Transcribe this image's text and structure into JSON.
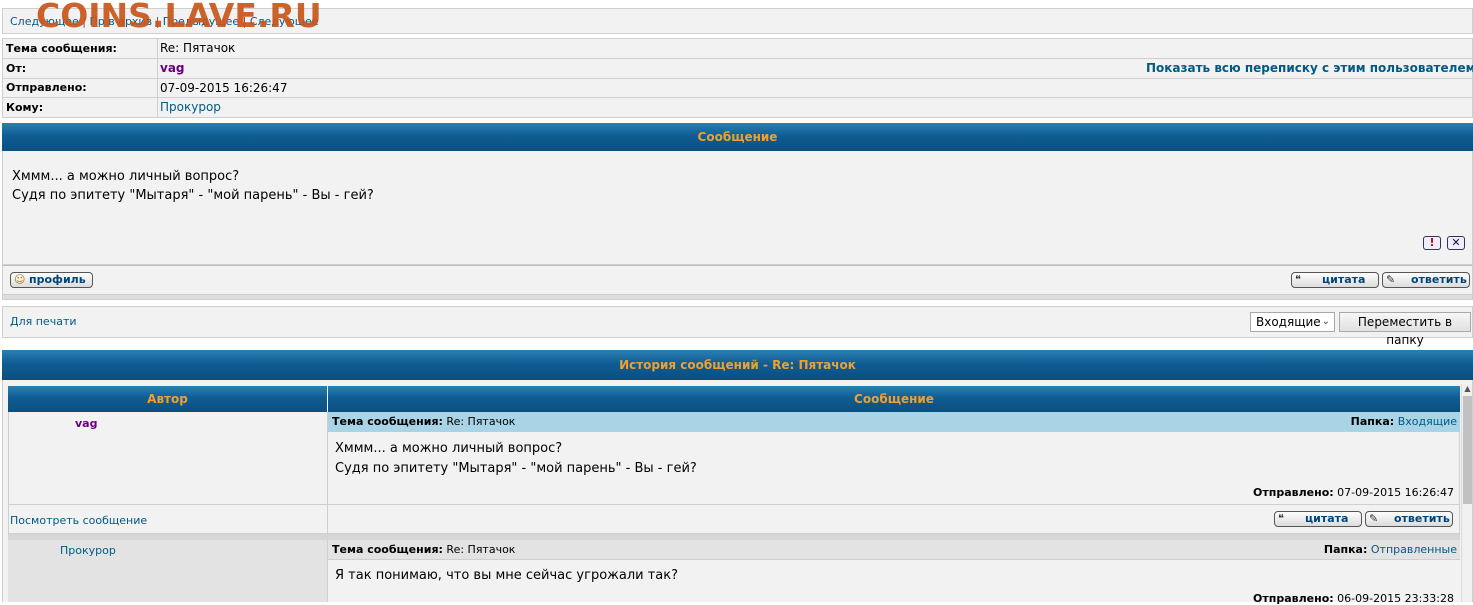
{
  "watermark": "COINS.LAVE.RU",
  "topnav": {
    "items": [
      "Следующее",
      "Пр в архив",
      "Предыдущее",
      "Следующее"
    ],
    "sep": "|"
  },
  "header": {
    "subject_label": "Тема сообщения:",
    "subject_value": "Re: Пятачок",
    "from_label": "От:",
    "from_value": "vag",
    "show_all_link": "Показать всю переписку с этим пользователем",
    "sent_label": "Отправлено:",
    "sent_value": "07-09-2015 16:26:47",
    "to_label": "Кому:",
    "to_value": "Прокурор"
  },
  "message": {
    "title": "Сообщение",
    "line1": "Хммм... а можно личный вопрос?",
    "line2": "Судя по эпитету \"Мытаря\" - \"мой парень\" - Вы - гей?",
    "profile_btn": "профиль",
    "quote_btn": "цитата",
    "reply_btn": "ответить"
  },
  "toolbar": {
    "print_link": "Для печати",
    "folder_select": "Входящие",
    "move_btn": "Переместить в папку"
  },
  "history": {
    "title": "История сообщений - Re: Пятачок",
    "col_author": "Автор",
    "col_message": "Сообщение",
    "view_msg_link": "Посмотреть сообщение",
    "entries": [
      {
        "author": "vag",
        "subject_label": "Тема сообщения:",
        "subject": "Re: Пятачок",
        "folder_label": "Папка:",
        "folder": "Входящие",
        "line1": "Хммм... а можно личный вопрос?",
        "line2": "Судя по эпитету \"Мытаря\" - \"мой парень\" - Вы - гей?",
        "sent_label": "Отправлено:",
        "sent": "07-09-2015 16:26:47",
        "quote_btn": "цитата",
        "reply_btn": "ответить"
      },
      {
        "author": "Прокурор",
        "subject_label": "Тема сообщения:",
        "subject": "Re: Пятачок",
        "folder_label": "Папка:",
        "folder": "Отправленные",
        "line1": "Я так понимаю, что вы мне сейчас угрожали так?",
        "sent_label": "Отправлено:",
        "sent": "06-09-2015 23:33:28"
      }
    ]
  }
}
